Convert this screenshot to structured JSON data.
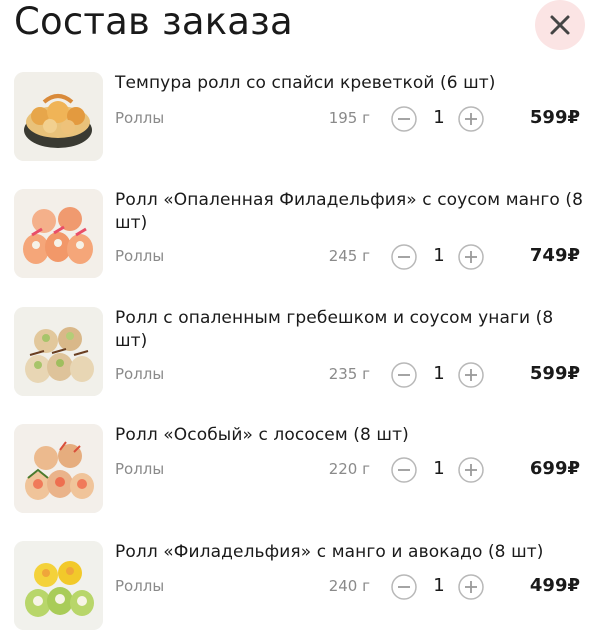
{
  "header": {
    "title": "Состав заказа",
    "close_icon": "close-icon"
  },
  "colors": {
    "close_bg": "#fbe4e4",
    "close_x": "#444444",
    "muted": "#8a8a8a",
    "stepper": "#b8b8b8"
  },
  "items": [
    {
      "name": "Темпура ролл со спайси креветкой (6 шт)",
      "category": "Роллы",
      "weight": "195 г",
      "qty": "1",
      "price": "599₽"
    },
    {
      "name": "Ролл «Опаленная Филадельфия» с соусом манго (8 шт)",
      "category": "Роллы",
      "weight": "245 г",
      "qty": "1",
      "price": "749₽"
    },
    {
      "name": "Ролл с опаленным гребешком и соусом унаги (8 шт)",
      "category": "Роллы",
      "weight": "235 г",
      "qty": "1",
      "price": "599₽"
    },
    {
      "name": "Ролл «Особый» с лососем (8 шт)",
      "category": "Роллы",
      "weight": "220 г",
      "qty": "1",
      "price": "699₽"
    },
    {
      "name": "Ролл «Филадельфия» с манго и авокадо (8 шт)",
      "category": "Роллы",
      "weight": "240 г",
      "qty": "1",
      "price": "499₽"
    }
  ]
}
